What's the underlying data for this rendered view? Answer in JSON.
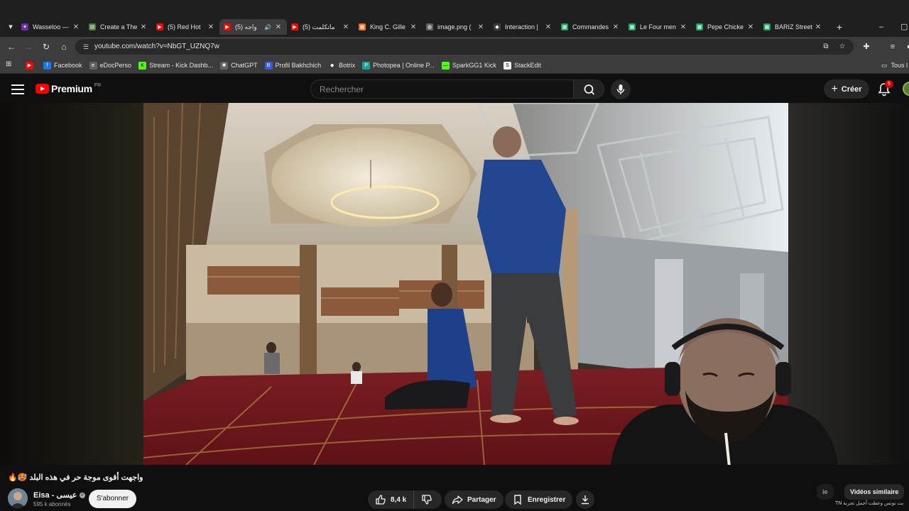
{
  "browser": {
    "tabs": [
      {
        "title": "Wasseloo —",
        "icon": "wasseloo-icon",
        "color": "#6b2fa8",
        "glyph": "✦"
      },
      {
        "title": "Create a The",
        "icon": "create-icon",
        "color": "#4f7a3a",
        "glyph": "▤"
      },
      {
        "title": "(5) Red Hot",
        "icon": "youtube-icon",
        "color": "#ff0000",
        "glyph": "▶"
      },
      {
        "title": "(5) واجه",
        "icon": "youtube-icon",
        "color": "#ff0000",
        "glyph": "▶",
        "active": true,
        "audio": true
      },
      {
        "title": "(5) ماتكلمت",
        "icon": "youtube-icon",
        "color": "#ff0000",
        "glyph": "▶"
      },
      {
        "title": "King C. Gille",
        "icon": "shop-icon",
        "color": "#f26b1d",
        "glyph": "▦"
      },
      {
        "title": "image.png (",
        "icon": "globe-icon",
        "color": "#5f6368",
        "glyph": "◍"
      },
      {
        "title": "Interaction |",
        "icon": "interaction-icon",
        "color": "#3c3c3c",
        "glyph": "◆"
      },
      {
        "title": "Commandes",
        "icon": "sheets-icon",
        "color": "#1aa260",
        "glyph": "▦"
      },
      {
        "title": "Le Four men",
        "icon": "sheets-icon",
        "color": "#1aa260",
        "glyph": "▦"
      },
      {
        "title": "Pepe Chicke",
        "icon": "sheets-icon",
        "color": "#1aa260",
        "glyph": "▦"
      },
      {
        "title": "BARIZ Street",
        "icon": "sheets-icon",
        "color": "#1aa260",
        "glyph": "▦"
      }
    ],
    "url": "youtube.com/watch?v=NbGT_UZNQ7w",
    "bookmarks": [
      {
        "label": "",
        "icon": "youtube-icon",
        "color": "#ff0000",
        "glyph": "▶"
      },
      {
        "label": "Facebook",
        "icon": "facebook-icon",
        "color": "#1877f2",
        "glyph": "f"
      },
      {
        "label": "eDocPerso",
        "icon": "edocperso-icon",
        "color": "#5f6368",
        "glyph": "e"
      },
      {
        "label": "Stream - Kick Dashb...",
        "icon": "kick-icon",
        "color": "#53fc18",
        "glyph": "K"
      },
      {
        "label": "ChatGPT",
        "icon": "chatgpt-icon",
        "color": "#5f6368",
        "glyph": "✺"
      },
      {
        "label": "Profil Bakhchich",
        "icon": "bakhchich-icon",
        "color": "#3b5bdb",
        "glyph": "B"
      },
      {
        "label": "Botrix",
        "icon": "botrix-icon",
        "color": "#3c3c3c",
        "glyph": "◆"
      },
      {
        "label": "Photopea | Online P...",
        "icon": "photopea-icon",
        "color": "#18a497",
        "glyph": "P"
      },
      {
        "label": "SparkGG1 Kick",
        "icon": "kick-icon",
        "color": "#53fc18",
        "glyph": "—"
      },
      {
        "label": "StackEdit",
        "icon": "stackedit-icon",
        "color": "#f1f1f1",
        "glyph": "S"
      }
    ],
    "all_bookmarks_label": "Tous l"
  },
  "youtube": {
    "logo_text": "Premium",
    "region": "FR",
    "search_placeholder": "Rechercher",
    "create_label": "Créer",
    "notification_count": "5",
    "video": {
      "title": "واجهت أقوى موجة حر في هذه البلد 🥵🔥",
      "channel_name": "Eisa - عيسى",
      "subscribers": "595 k abonnés",
      "subscribe_label": "S'abonner",
      "likes": "8,4 k",
      "share_label": "Partager",
      "save_label": "Enregistrer"
    },
    "chips": {
      "partial_label": "ie",
      "similar_label": "Vidéos similaire"
    },
    "related_title": "بت تونس وعطت أجمل تجربة",
    "related_badge": "TN"
  }
}
